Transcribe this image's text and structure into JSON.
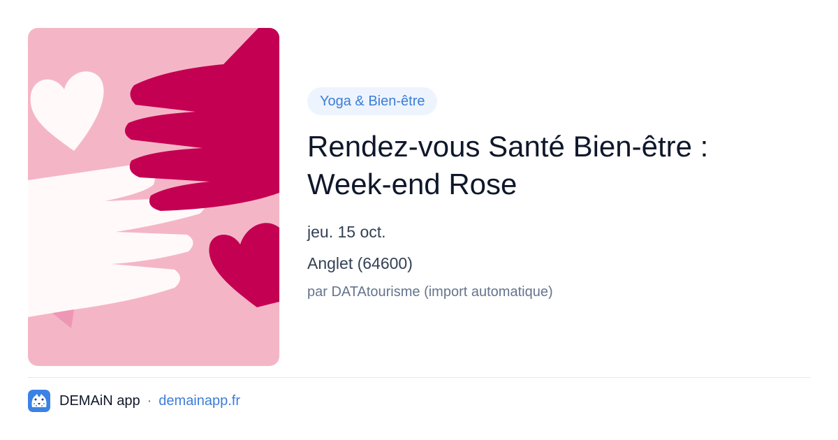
{
  "event": {
    "category_tag": "Yoga & Bien-être",
    "title_line1": "Rendez-vous Santé Bien-être :",
    "title_line2": "Week-end Rose",
    "date": "jeu. 15 oct.",
    "location": "Anglet (64600)",
    "source": "par DATAtourisme (import automatique)"
  },
  "illustration": {
    "icons": [
      "hands-icon",
      "heart-icon",
      "pink-ribbon-icon"
    ],
    "colors": {
      "background": "#f4b6c6",
      "magenta_hand": "#c40052",
      "white_hand": "#fff9fa",
      "ribbon": "#ee97b5"
    }
  },
  "footer": {
    "app_name": "DEMAiN app",
    "separator": "·",
    "site": "demainapp.fr",
    "app_icon": "leopard-logo-icon"
  },
  "colors": {
    "accent": "#3b7dd8",
    "tag_background": "#edf4fd",
    "title": "#0f172a",
    "meta": "#334155",
    "muted": "#64748b",
    "divider": "#e2e8f0"
  }
}
